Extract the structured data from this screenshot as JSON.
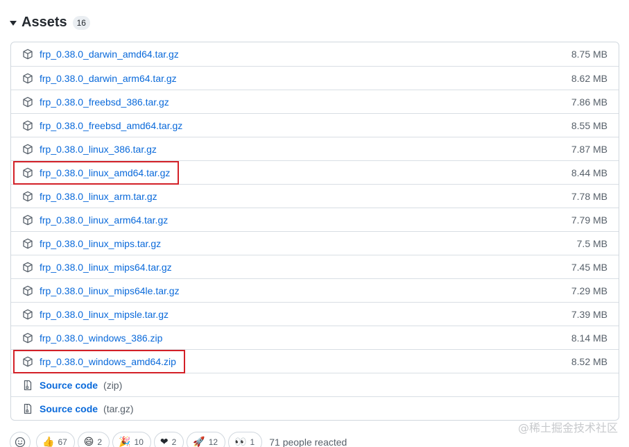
{
  "assets": {
    "title": "Assets",
    "count": "16",
    "files": [
      {
        "name": "frp_0.38.0_darwin_amd64.tar.gz",
        "size": "8.75 MB"
      },
      {
        "name": "frp_0.38.0_darwin_arm64.tar.gz",
        "size": "8.62 MB"
      },
      {
        "name": "frp_0.38.0_freebsd_386.tar.gz",
        "size": "7.86 MB"
      },
      {
        "name": "frp_0.38.0_freebsd_amd64.tar.gz",
        "size": "8.55 MB"
      },
      {
        "name": "frp_0.38.0_linux_386.tar.gz",
        "size": "7.87 MB"
      },
      {
        "name": "frp_0.38.0_linux_amd64.tar.gz",
        "size": "8.44 MB",
        "highlighted": true
      },
      {
        "name": "frp_0.38.0_linux_arm.tar.gz",
        "size": "7.78 MB"
      },
      {
        "name": "frp_0.38.0_linux_arm64.tar.gz",
        "size": "7.79 MB"
      },
      {
        "name": "frp_0.38.0_linux_mips.tar.gz",
        "size": "7.5 MB"
      },
      {
        "name": "frp_0.38.0_linux_mips64.tar.gz",
        "size": "7.45 MB"
      },
      {
        "name": "frp_0.38.0_linux_mips64le.tar.gz",
        "size": "7.29 MB"
      },
      {
        "name": "frp_0.38.0_linux_mipsle.tar.gz",
        "size": "7.39 MB"
      },
      {
        "name": "frp_0.38.0_windows_386.zip",
        "size": "8.14 MB"
      },
      {
        "name": "frp_0.38.0_windows_amd64.zip",
        "size": "8.52 MB",
        "highlighted": true
      }
    ],
    "sources": [
      {
        "label": "Source code",
        "format": "(zip)"
      },
      {
        "label": "Source code",
        "format": "(tar.gz)"
      }
    ]
  },
  "reactions": {
    "items": [
      {
        "emoji": "👍",
        "icon": "thumbs-up-icon",
        "count": "67"
      },
      {
        "emoji": "😄",
        "icon": "laugh-icon",
        "count": "2"
      },
      {
        "emoji": "🎉",
        "icon": "hooray-icon",
        "count": "10"
      },
      {
        "emoji": "❤",
        "icon": "heart-icon",
        "count": "2"
      },
      {
        "emoji": "🚀",
        "icon": "rocket-icon",
        "count": "12"
      },
      {
        "emoji": "👀",
        "icon": "eyes-icon",
        "count": "1"
      }
    ],
    "summary": "71 people reacted"
  },
  "watermark": "@稀土掘金技术社区",
  "colors": {
    "link": "#0969da",
    "highlight": "#d32027",
    "muted": "#57606a"
  }
}
